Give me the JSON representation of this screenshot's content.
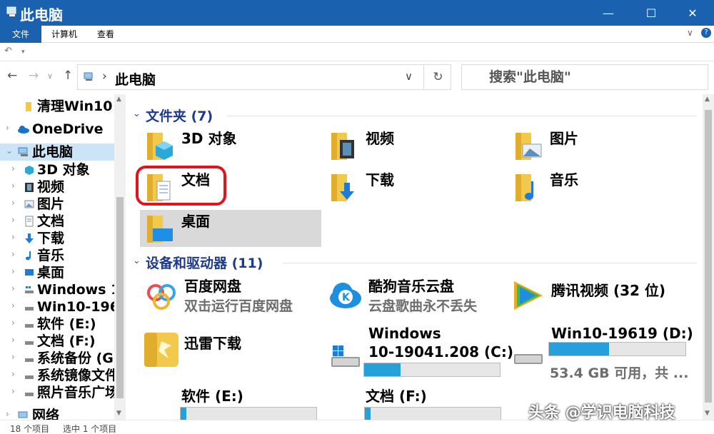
{
  "window": {
    "title": "此电脑",
    "controls": {
      "minimize": "—",
      "maximize": "☐",
      "close": "✕"
    }
  },
  "ribbon": {
    "tabs": [
      "文件",
      "计算机",
      "查看"
    ],
    "collapse_glyph": "∨",
    "help_glyph": "?"
  },
  "address": {
    "back": "←",
    "forward": "→",
    "recent": "∨",
    "up": "↑",
    "separator": "›",
    "crumb": "此电脑",
    "dropdown": "∨",
    "refresh": "↻"
  },
  "search": {
    "placeholder": "搜索\"此电脑\""
  },
  "sidebar": {
    "items": [
      {
        "label": "清理Win10",
        "icon": "folder-yellow-icon"
      },
      {
        "label": "OneDrive",
        "icon": "cloud-icon"
      },
      {
        "label": "此电脑",
        "icon": "computer-icon"
      },
      {
        "label": "3D 对象",
        "icon": "cube-icon"
      },
      {
        "label": "视频",
        "icon": "film-icon"
      },
      {
        "label": "图片",
        "icon": "picture-icon"
      },
      {
        "label": "文档",
        "icon": "document-icon"
      },
      {
        "label": "下载",
        "icon": "download-arrow-icon"
      },
      {
        "label": "音乐",
        "icon": "music-note-icon"
      },
      {
        "label": "桌面",
        "icon": "desktop-icon"
      },
      {
        "label": "Windows 1",
        "icon": "windows-drive-icon"
      },
      {
        "label": "Win10-196",
        "icon": "drive-icon"
      },
      {
        "label": "软件 (E:)",
        "icon": "drive-icon"
      },
      {
        "label": "文档 (F:)",
        "icon": "drive-icon"
      },
      {
        "label": "系统备份 (G",
        "icon": "drive-icon"
      },
      {
        "label": "系统镜像文件",
        "icon": "drive-icon"
      },
      {
        "label": "照片音乐广场",
        "icon": "drive-icon"
      },
      {
        "label": "网络",
        "icon": "network-icon"
      }
    ]
  },
  "folders": {
    "header": "文件夹 (7)",
    "items": [
      {
        "name": "3D 对象",
        "icon": "cube-folder-icon"
      },
      {
        "name": "视频",
        "icon": "video-folder-icon"
      },
      {
        "name": "图片",
        "icon": "pictures-folder-icon"
      },
      {
        "name": "文档",
        "icon": "documents-folder-icon"
      },
      {
        "name": "下载",
        "icon": "downloads-folder-icon"
      },
      {
        "name": "音乐",
        "icon": "music-folder-icon"
      },
      {
        "name": "桌面",
        "icon": "desktop-folder-icon"
      }
    ]
  },
  "devices": {
    "header": "设备和驱动器 (11)",
    "items": [
      {
        "name": "百度网盘",
        "sub": "双击运行百度网盘",
        "icon": "baidu-netdisk-icon"
      },
      {
        "name": "酷狗音乐云盘",
        "sub": "云盘歌曲永不丢失",
        "icon": "kugou-icon"
      },
      {
        "name": "腾讯视频 (32 位)",
        "sub": "",
        "icon": "tencent-video-icon"
      },
      {
        "name": "迅雷下载",
        "sub": "",
        "icon": "xunlei-icon"
      },
      {
        "name_line1": "Windows",
        "name_line2": "10-19041.208 (C:)",
        "usage": 0.27,
        "icon": "windows-drive-icon"
      },
      {
        "name": "Win10-19619 (D:)",
        "free": "53.4 GB 可用，共 ...",
        "usage": 0.44,
        "icon": "hard-drive-icon"
      },
      {
        "name": "软件 (E:)",
        "usage": 0.04,
        "icon": "hard-drive-icon"
      },
      {
        "name": "文档 (F:)",
        "usage": 0.04,
        "icon": "hard-drive-icon"
      }
    ]
  },
  "status": {
    "count": "18 个项目",
    "selected": "选中 1 个项目"
  },
  "watermark": "头条 @学识电脑科技",
  "colors": {
    "titlebar": "#1a61b0",
    "selection": "#cce4f7",
    "usage_bar": "#26a0da",
    "highlight": "#e0141b"
  }
}
